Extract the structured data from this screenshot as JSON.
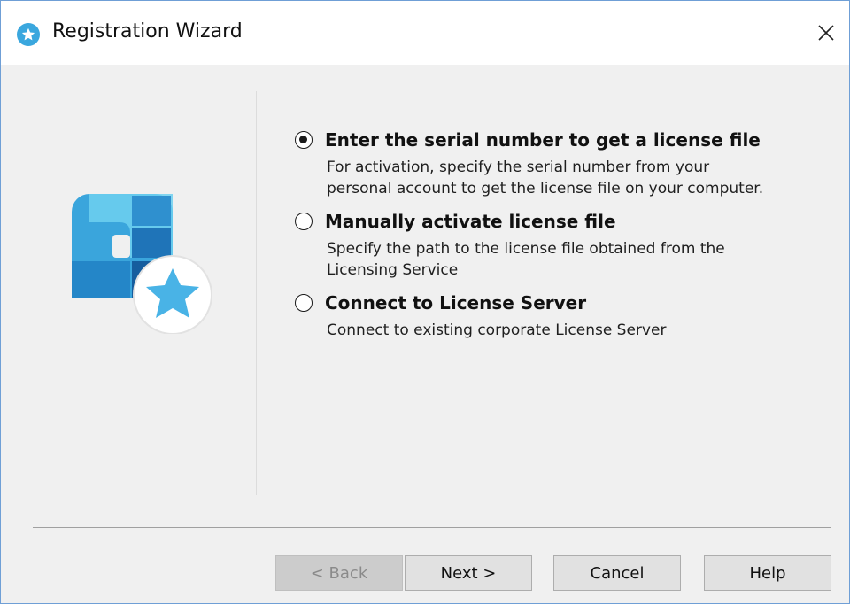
{
  "window": {
    "title": "Registration Wizard",
    "icon": "star-badge-icon",
    "close_icon": "close-icon",
    "accent_color": "#3aa7de"
  },
  "options": [
    {
      "label": "Enter the serial number to get a license file",
      "description": "For activation, specify the serial number from your\npersonal account to get the license file on your computer.",
      "selected": true
    },
    {
      "label": "Manually activate license file",
      "description": "Specify the path to the license file obtained from the\nLicensing Service",
      "selected": false
    },
    {
      "label": "Connect to License Server",
      "description": "Connect to existing corporate License Server",
      "selected": false
    }
  ],
  "buttons": {
    "back": "< Back",
    "back_enabled": false,
    "next": "Next >",
    "cancel": "Cancel",
    "help": "Help"
  }
}
